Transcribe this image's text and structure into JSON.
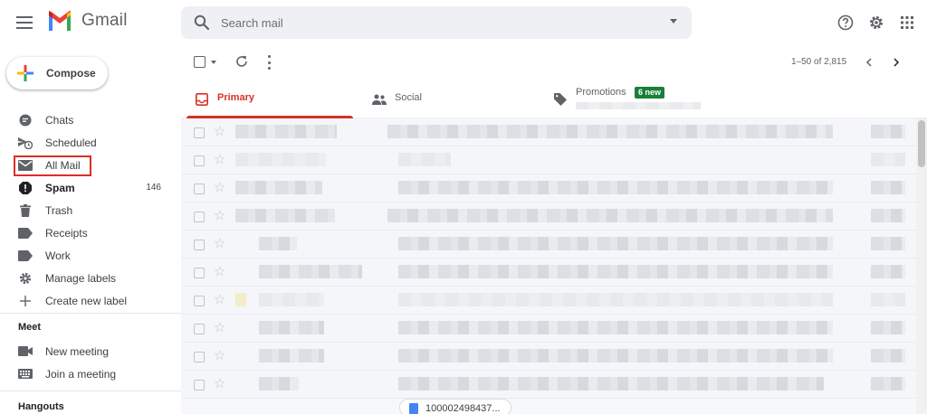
{
  "header": {
    "app_name": "Gmail",
    "search_placeholder": "Search mail",
    "icons": [
      "menu-icon",
      "help-icon",
      "settings-icon",
      "apps-icon"
    ]
  },
  "sidebar": {
    "compose_label": "Compose",
    "items": [
      {
        "label": "Chats",
        "icon": "chat-icon"
      },
      {
        "label": "Scheduled",
        "icon": "scheduled-icon"
      },
      {
        "label": "All Mail",
        "icon": "mail-icon",
        "highlighted": true
      },
      {
        "label": "Spam",
        "icon": "spam-icon",
        "count": "146",
        "bold": true
      },
      {
        "label": "Trash",
        "icon": "trash-icon"
      },
      {
        "label": "Receipts",
        "icon": "label-icon"
      },
      {
        "label": "Work",
        "icon": "label-icon"
      },
      {
        "label": "Manage labels",
        "icon": "gear-icon"
      },
      {
        "label": "Create new label",
        "icon": "plus-icon"
      }
    ],
    "meet": {
      "title": "Meet",
      "items": [
        {
          "label": "New meeting",
          "icon": "video-icon"
        },
        {
          "label": "Join a meeting",
          "icon": "keyboard-icon"
        }
      ]
    },
    "hangouts_title": "Hangouts"
  },
  "toolbar": {
    "paging": "1–50 of 2,815"
  },
  "tabs": [
    {
      "label": "Primary",
      "icon": "inbox-icon",
      "active": true
    },
    {
      "label": "Social",
      "icon": "people-icon"
    },
    {
      "label": "Promotions",
      "icon": "tag-icon",
      "badge": "6 new"
    }
  ],
  "attachment": {
    "label": "100002498437..."
  },
  "colors": {
    "accent_red": "#d93025",
    "badge_green": "#188038",
    "search_bg": "#eef0f3"
  }
}
